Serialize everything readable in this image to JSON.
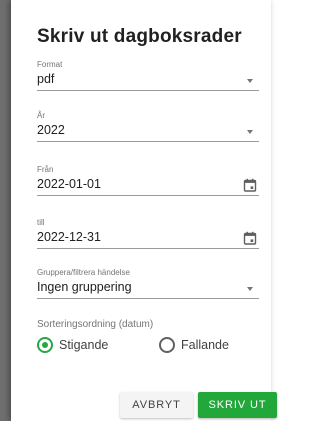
{
  "dialog": {
    "title": "Skriv ut dagboksrader",
    "fields": [
      {
        "label": "Format",
        "value": "pdf",
        "control": "chevron-down-icon"
      },
      {
        "label": "År",
        "value": "2022",
        "control": "chevron-down-icon"
      },
      {
        "label": "Från",
        "value": "2022-01-01",
        "control": "calendar-icon"
      },
      {
        "label": "till",
        "value": "2022-12-31",
        "control": "calendar-icon"
      },
      {
        "label": "Gruppera/filtrera händelse",
        "value": "Ingen gruppering",
        "control": "chevron-down-icon"
      }
    ],
    "sort": {
      "label": "Sorteringsordning (datum)",
      "options": [
        {
          "label": "Stigande",
          "checked": true
        },
        {
          "label": "Fallande",
          "checked": false
        }
      ]
    },
    "buttons": {
      "cancel": "AVBRYT",
      "print": "SKRIV UT"
    }
  },
  "colors": {
    "accent": "#27a744",
    "primary_button": "#22a83a",
    "backdrop": "#6f6f6f"
  }
}
